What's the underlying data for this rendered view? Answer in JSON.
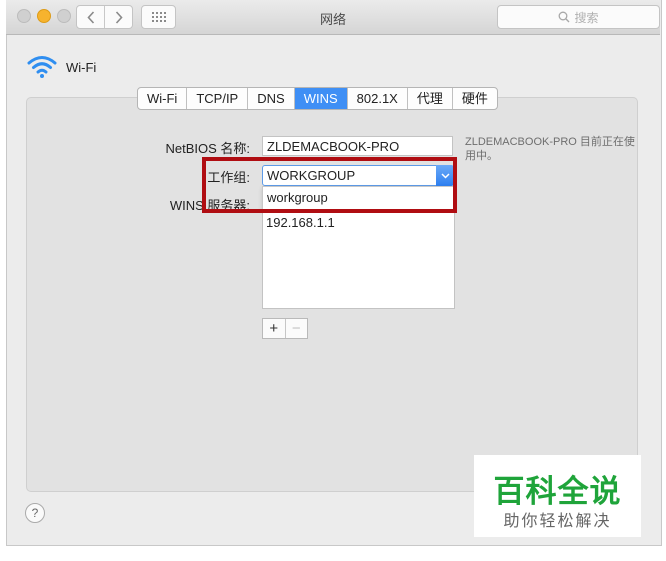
{
  "window": {
    "title": "网络"
  },
  "search": {
    "placeholder": "搜索"
  },
  "interface": {
    "name": "Wi-Fi"
  },
  "tabs": [
    {
      "label": "Wi-Fi",
      "active": false
    },
    {
      "label": "TCP/IP",
      "active": false
    },
    {
      "label": "DNS",
      "active": false
    },
    {
      "label": "WINS",
      "active": true
    },
    {
      "label": "802.1X",
      "active": false
    },
    {
      "label": "代理",
      "active": false
    },
    {
      "label": "硬件",
      "active": false
    }
  ],
  "form": {
    "netbios_label": "NetBIOS 名称:",
    "netbios_value": "ZLDEMACBOOK-PRO",
    "netbios_note": "ZLDEMACBOOK-PRO 目前正在使用中。",
    "workgroup_label": "工作组:",
    "workgroup_value": "WORKGROUP",
    "workgroup_option": "workgroup",
    "wins_label": "WINS 服务器:",
    "wins_servers": [
      "192.168.1.1"
    ]
  },
  "buttons": {
    "add": "+",
    "remove": "−",
    "help": "?"
  },
  "watermark": {
    "title": "百科全说",
    "subtitle": "助你轻松解决"
  },
  "colors": {
    "accent": "#3f8ff5",
    "highlight": "#b00d12",
    "watermark": "#1fa43a"
  }
}
